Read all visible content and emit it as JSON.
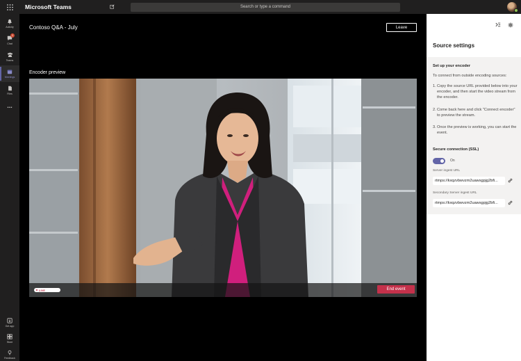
{
  "app": {
    "title": "Microsoft Teams"
  },
  "search": {
    "placeholder": "Search or type a command"
  },
  "rail": {
    "items": [
      {
        "label": "Activity",
        "icon": "bell-icon"
      },
      {
        "label": "Chat",
        "icon": "chat-icon",
        "badge": "1"
      },
      {
        "label": "Teams",
        "icon": "teams-icon"
      },
      {
        "label": "Meetings",
        "icon": "calendar-icon",
        "active": true
      },
      {
        "label": "Files",
        "icon": "files-icon"
      },
      {
        "label": "...",
        "icon": "more-icon"
      }
    ],
    "bottom": [
      {
        "label": "Get app",
        "icon": "download-icon"
      },
      {
        "label": "Store",
        "icon": "store-icon"
      },
      {
        "label": "Feedback",
        "icon": "feedback-icon"
      }
    ]
  },
  "meeting": {
    "title": "Contoso Q&A - July",
    "leave_label": "Leave",
    "preview_label": "Encoder preview",
    "live_label": "LIVE",
    "end_label": "End event"
  },
  "panel": {
    "heading": "Source settings",
    "setup_title": "Set up your encoder",
    "intro": "To connect from outside encoding sources:",
    "steps": [
      {
        "num": "1.",
        "text": "Copy the source URL provided below into your encoder, and then start the video stream from the encoder."
      },
      {
        "num": "2.",
        "text": "Come back here and click \"Connect encoder\" to preview the stream."
      },
      {
        "num": "3.",
        "text": "Once the preview is working, you can start the event."
      }
    ],
    "ssl_title": "Secure connection (SSL)",
    "ssl_state": "On",
    "server_label": "Server ingest URL",
    "server_value": "rtmps://kxqzvbwvzm2uawsgpjg2bfi...",
    "secondary_label": "Secondary Server ingest URL",
    "secondary_value": "rtmps://kxqzvbwvzm2uawsgpjg2bfi..."
  },
  "colors": {
    "accent": "#6264a7",
    "end": "#c4314b",
    "rail": "#201f1f"
  }
}
